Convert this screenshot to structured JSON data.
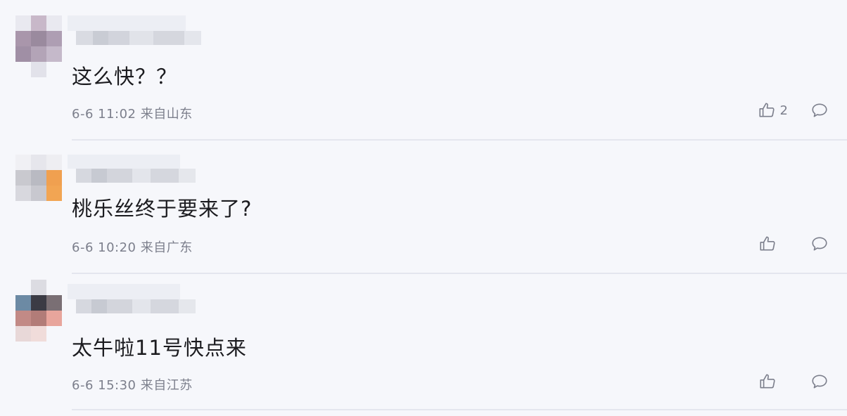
{
  "comments": [
    {
      "content": "这么快？？",
      "date": "6-6",
      "time": "11:02",
      "location": "来自山东",
      "likes": "2"
    },
    {
      "content": "桃乐丝终于要来了?",
      "date": "6-6",
      "time": "10:20",
      "location": "来自广东",
      "likes": ""
    },
    {
      "content": "太牛啦11号快点来",
      "date": "6-6",
      "time": "15:30",
      "location": "来自江苏",
      "likes": ""
    }
  ],
  "icons": {
    "like": "thumbs-up-icon",
    "reply": "comment-bubble-icon"
  },
  "colors": {
    "background": "#f6f7fb",
    "meta_text": "#7c7f8c",
    "divider": "#e4e6ee"
  }
}
